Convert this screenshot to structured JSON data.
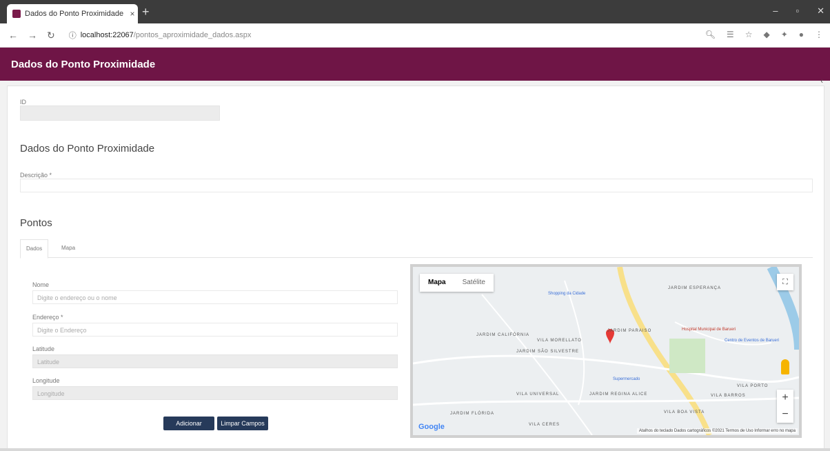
{
  "browser": {
    "tab_title": "Dados do Ponto Proximidade",
    "tab_close": "×",
    "new_tab": "+",
    "win_min": "–",
    "win_max": "▫",
    "win_close": "✕",
    "url_host": "localhost:22067",
    "url_path": "/pontos_aproximidade_dados.aspx"
  },
  "header": {
    "title": "Dados do Ponto Proximidade",
    "collapse": "‹"
  },
  "form": {
    "id_label": "ID",
    "section1_title": "Dados do Ponto Proximidade",
    "descricao_label": "Descrição *",
    "section2_title": "Pontos",
    "tabs": [
      "Dados",
      "Mapa"
    ],
    "nome_label": "Nome",
    "nome_placeholder": "Digite o endereço ou o nome",
    "endereco_label": "Endereço *",
    "endereco_placeholder": "Digite o Endereço",
    "latitude_label": "Latitude",
    "latitude_placeholder": "Latitude",
    "longitude_label": "Longitude",
    "longitude_placeholder": "Longitude",
    "add_button": "Adicionar",
    "clear_button": "Limpar Campos"
  },
  "map": {
    "type_map": "Mapa",
    "type_sat": "Satélite",
    "fullscreen": "⛶",
    "zoom_in": "+",
    "zoom_out": "−",
    "google": "Google",
    "attribution": "Atalhos do teclado   Dados cartográficos ©2021   Termos de Uso   Informar erro no mapa",
    "labels": [
      "JARDIM ESPERANÇA",
      "JARDIM PARAISO",
      "JARDIM CALIFÓRNIA",
      "VILA MORELLATO",
      "JARDIM SÃO SILVESTRE",
      "VILA UNIVERSAL",
      "JARDIM REGINA ALICE",
      "VILA BARROS",
      "VILA PORTO",
      "JARDIM FLÓRIDA",
      "VILA CERES",
      "VILA BOA VISTA"
    ],
    "pois": [
      "Shopping da Cidade",
      "Hospital Municipal de Barueri",
      "Centro de Eventos de Barueri",
      "Supermercado"
    ]
  }
}
